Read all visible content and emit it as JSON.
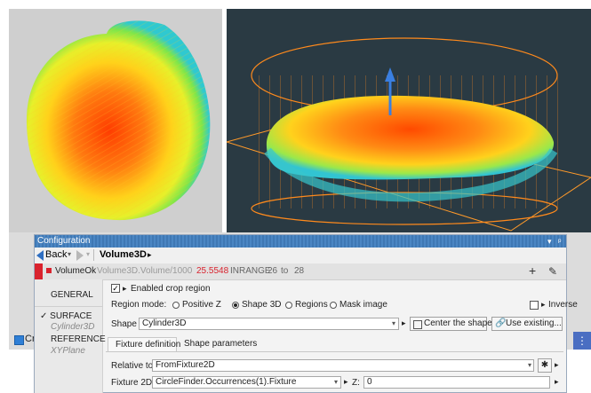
{
  "strip": {
    "text": "Cr",
    "blue_glyph": "⋮"
  },
  "config": {
    "title": "Configuration",
    "title_icons": [
      "▾",
      "ᵖ"
    ],
    "nav": {
      "back_label": "Back",
      "current": "Volume3D"
    },
    "status": {
      "name": "VolumeOk",
      "expr": "Volume3D.Volume/1000",
      "value": "25.5548",
      "range_label": "INRANGE",
      "range_low": "26",
      "range_to": "to",
      "range_high": "28",
      "add_glyph": "+",
      "edit_glyph": "✎"
    },
    "sidebar": {
      "general": "GENERAL",
      "surface": "✓ SURFACE",
      "surface_sub": "Cylinder3D",
      "reference": "REFERENCE",
      "reference_sub": "XYPlane"
    },
    "crop": {
      "label": "Enabled crop region"
    },
    "region_mode": {
      "label": "Region mode:",
      "options": [
        "Positive Z",
        "Shape 3D",
        "Regions",
        "Mask image"
      ],
      "selected": "Shape 3D",
      "inverse": "Inverse"
    },
    "shape": {
      "label": "Shape :",
      "value": "Cylinder3D",
      "center_btn": "Center the shape",
      "use_btn": "Use existing..."
    },
    "tabs": [
      "Fixture definition",
      "Shape parameters"
    ],
    "relative": {
      "label": "Relative to:",
      "value": "FromFixture2D"
    },
    "fixture2d": {
      "label": "Fixture 2D:",
      "value": "CircleFinder.Occurrences(1).Fixture",
      "z_label": "Z:",
      "z_value": "0"
    }
  },
  "colors": {
    "accent": "#3f78b4",
    "status_red": "#d9232e",
    "value_red": "#d9232e",
    "box_orange": "#ff8a1c"
  }
}
